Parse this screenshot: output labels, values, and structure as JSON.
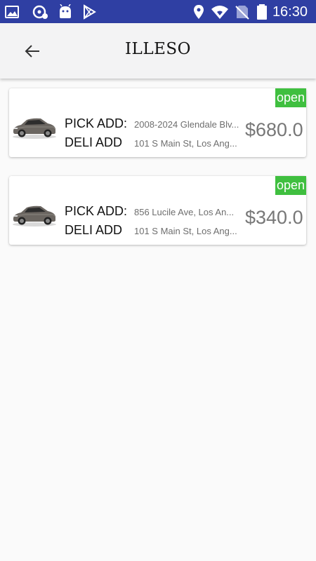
{
  "status_bar": {
    "time": "16:30",
    "icons": [
      "image-icon",
      "sync-icon",
      "android-icon",
      "play-store-icon",
      "location-icon",
      "wifi-icon",
      "no-sim-icon",
      "battery-icon"
    ]
  },
  "toolbar": {
    "title": "ILLESO",
    "back_icon": "arrow-left-icon"
  },
  "orders": [
    {
      "pick_label": "PICK ADD:",
      "pick_address": "2008-2024 Glendale Blv...",
      "deli_label": "DELI ADD",
      "deli_address": "101 S Main St, Los Ang...",
      "price": "$680.0",
      "status": "open",
      "image": "car-icon"
    },
    {
      "pick_label": "PICK ADD:",
      "pick_address": "856 Lucile Ave, Los An...",
      "deli_label": "DELI ADD",
      "deli_address": "101 S Main St, Los Ang...",
      "price": "$340.0",
      "status": "open",
      "image": "car-icon"
    }
  ],
  "colors": {
    "status_bar": "#2f3fa3",
    "toolbar": "#f3f3f4",
    "badge": "#3fbf3f",
    "price": "#777777"
  }
}
